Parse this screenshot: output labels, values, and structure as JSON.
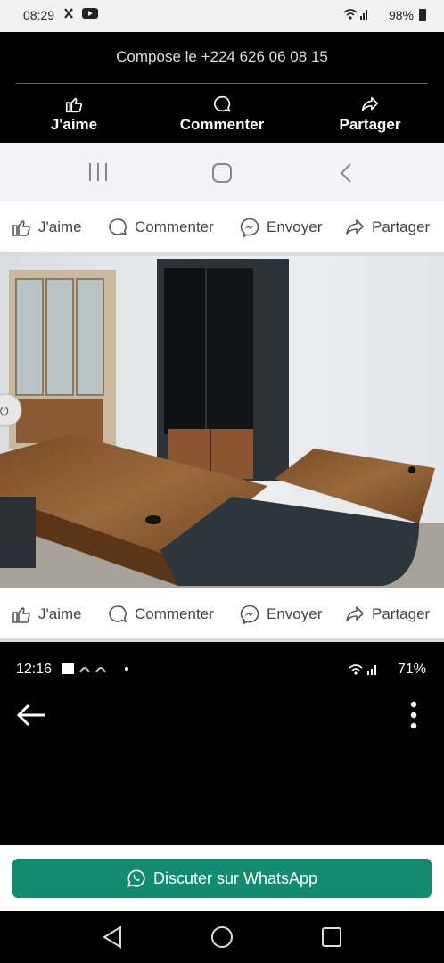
{
  "status_top": {
    "time": "08:29",
    "battery": "98%"
  },
  "video": {
    "compose_text": "Compose le +224 626 06 08 15",
    "actions": [
      {
        "label": "J'aime",
        "icon": "thumbs-up-icon"
      },
      {
        "label": "Commenter",
        "icon": "comment-icon"
      },
      {
        "label": "Partager",
        "icon": "share-icon"
      }
    ]
  },
  "fb_actions": {
    "like": "J'aime",
    "comment": "Commenter",
    "send": "Envoyer",
    "share": "Partager"
  },
  "status_second": {
    "time": "12:16",
    "battery": "71%"
  },
  "whatsapp": {
    "label": "Discuter sur WhatsApp",
    "color": "#128c6c"
  },
  "colors": {
    "accent_green": "#128c6c"
  }
}
